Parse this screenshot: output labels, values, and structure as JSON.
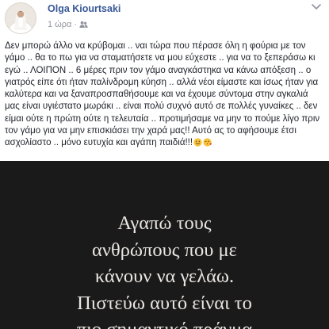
{
  "post": {
    "author_name": "Olga Kiourtsaki",
    "timestamp": "1 ώρα",
    "separator": "·",
    "privacy_icon": "friends-icon",
    "menu_icon": "more-options-icon",
    "text": "Δεν μπορώ άλλο να κρύβομαι .. ναι τώρα που πέρασε όλη η φούρια με τον γάμο .. θα το πω για να σταματήσετε να μου εύχεστε .. για να το ξεπεράσω κι εγώ .. ΛΟΙΠΟΝ .. 6 μέρες πριν τον γάμο αναγκάστηκα να κάνω απόξεση .. ο γιατρός είπε ότι ήταν παλίνδρομη κύηση .. αλλά νέοι είμαστε και ίσως ήταν για καλύτερα και να ξαναπροσπαθήσουμε και να έχουμε σύντομα στην αγκαλιά μας είναι υγιέστατο μωράκι .. είναι πολύ συχνό αυτό σε πολλές γυναίκες .. δεν είμαι ούτε η πρώτη ούτε η τελευταία .. προτιμήσαμε να μην το πούμε λίγο πριν τον γάμο για να μην επισκιάσει την χαρά μας!! Αυτό ας το αφήσουμε έτσι ασχολίαστο .. μόνο ευτυχία και αγάπη παιδιά!!!",
    "emojis": [
      "smiling-face-icon",
      "face-blowing-kiss-icon"
    ],
    "image_quote_lines": [
      "Αγαπώ τους",
      "ανθρώπους που με",
      "κάνουν να γελάω.",
      "Πιστεύω αυτό είναι το",
      "πιο σημαντικό πράγμα"
    ]
  },
  "colors": {
    "author_link": "#385898",
    "meta_text": "#90949c",
    "body_text": "#1d2129",
    "image_background": "#1b1a1a",
    "image_text": "#e9e6e1"
  }
}
